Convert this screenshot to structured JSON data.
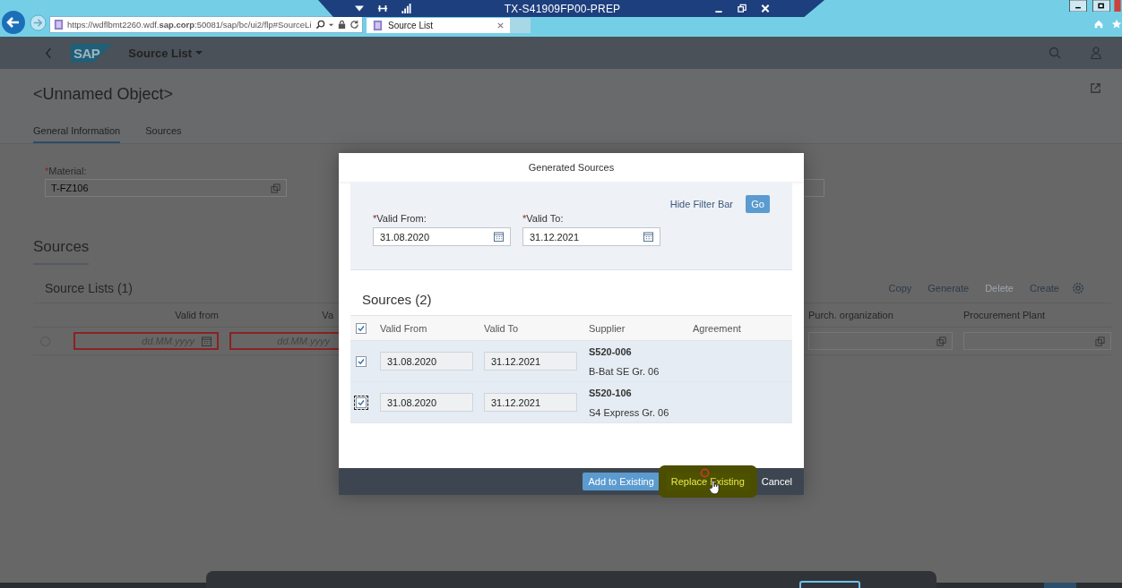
{
  "browser": {
    "url": "https://wdflbmt2260.wdf.**sap.corp**:50081/sap/bc/ui2/flp#SourceLi",
    "tab": "Source List"
  },
  "remote_session": {
    "title": "TX-S41909FP00-PREP"
  },
  "shell": {
    "logo": "SAP",
    "app_title": "Source List"
  },
  "object": {
    "title": "<Unnamed Object>"
  },
  "tabs": [
    {
      "label": "General Information",
      "selected": true
    },
    {
      "label": "Sources",
      "selected": false
    }
  ],
  "material": {
    "required_mark": "*",
    "label": "Material:",
    "value": "T-FZ106"
  },
  "section_title": "Sources",
  "source_lists": {
    "title": "Source Lists (1)",
    "actions": [
      {
        "label": "Copy",
        "disabled": false
      },
      {
        "label": "Generate",
        "disabled": false
      },
      {
        "label": "Delete",
        "disabled": true
      },
      {
        "label": "Create",
        "disabled": false
      }
    ],
    "columns": [
      "Valid from",
      "Va",
      "Purch. organization",
      "Procurement Plant"
    ],
    "rows": [
      {
        "selected": false,
        "error": true,
        "valid_from_placeholder": "dd.MM.yyyy",
        "valid_to_placeholder": "dd.MM.yyyy"
      }
    ]
  },
  "dialog": {
    "title": "Generated Sources",
    "hide_filter_bar": "Hide Filter Bar",
    "go": "Go",
    "filters": [
      {
        "required_mark": "*",
        "label": "Valid From:",
        "value": "31.08.2020"
      },
      {
        "required_mark": "*",
        "label": "Valid To:",
        "value": "31.12.2021"
      }
    ],
    "table_title": "Sources (2)",
    "select_all_checked": true,
    "columns": [
      "Valid From",
      "Valid To",
      "Supplier",
      "Agreement"
    ],
    "rows": [
      {
        "checked": true,
        "focused": false,
        "selected": true,
        "valid_from": "31.08.2020",
        "valid_to": "31.12.2021",
        "supplier_id": "S520-006",
        "supplier_name": "B-Bat SE Gr. 06"
      },
      {
        "checked": true,
        "focused": true,
        "selected": true,
        "valid_from": "31.08.2020",
        "valid_to": "31.12.2021",
        "supplier_id": "S520-106",
        "supplier_name": "S4 Express Gr. 06"
      }
    ],
    "buttons": [
      {
        "label": "Add to Existing",
        "kind": "emphasized",
        "highlighted": false
      },
      {
        "label": "Replace Existing",
        "kind": "default",
        "highlighted": true
      },
      {
        "label": "Cancel",
        "kind": "transparent",
        "highlighted": false
      }
    ]
  }
}
